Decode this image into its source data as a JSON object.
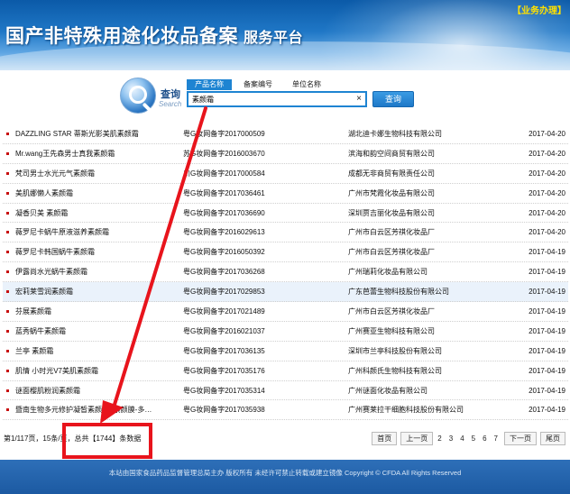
{
  "header": {
    "title": "国产非特殊用途化妆品备案",
    "subtitle": "服务平台",
    "business_link": "【业务办理】"
  },
  "search": {
    "label": "查询",
    "label_en": "Search",
    "tabs": [
      {
        "label": "产品名称",
        "active": true
      },
      {
        "label": "备案编号",
        "active": false
      },
      {
        "label": "单位名称",
        "active": false
      }
    ],
    "value": "素颜霜",
    "clear_symbol": "×",
    "button_label": "查询"
  },
  "results": [
    {
      "name": "DAZZLING STAR 蒂斯光影美肌素颜霜",
      "reg": "粤G妆网备字2017000509",
      "company": "湖北迪卡娜生物科技有限公司",
      "date": "2017-04-20"
    },
    {
      "name": "Mr.wang王先森男士真我素颜霜",
      "reg": "苏G妆网备字2016003670",
      "company": "滨海和韵空间商贸有限公司",
      "date": "2017-04-20"
    },
    {
      "name": "梵司男士水光元气素颜霜",
      "reg": "川G妆网备字2017000584",
      "company": "成都无非商贸有限责任公司",
      "date": "2017-04-20"
    },
    {
      "name": "美肌娜懒人素颜霜",
      "reg": "粤G妆网备字2017036461",
      "company": "广州市梵霞化妆品有限公司",
      "date": "2017-04-20"
    },
    {
      "name": "凝香贝美 素颜霜",
      "reg": "粤G妆网备字2017036690",
      "company": "深圳贾吉丽化妆品有限公司",
      "date": "2017-04-20"
    },
    {
      "name": "薇罗尼卡蜗牛原液滋养素颜霜",
      "reg": "粤G妆网备字2016029613",
      "company": "广州市白云区芳祺化妆品厂",
      "date": "2017-04-20"
    },
    {
      "name": "薇罗尼卡韩国蜗牛素颜霜",
      "reg": "粤G妆网备字2016050392",
      "company": "广州市白云区芳祺化妆品厂",
      "date": "2017-04-19"
    },
    {
      "name": "伊露尚水光蜗牛素颜霜",
      "reg": "粤G妆网备字2017036268",
      "company": "广州瑞莉化妆品有限公司",
      "date": "2017-04-19"
    },
    {
      "name": "宏莉莱雪润素颜霜",
      "reg": "粤G妆网备字2017029853",
      "company": "广东芭蕾生物科技股份有限公司",
      "date": "2017-04-19"
    },
    {
      "name": "芬展素颜霜",
      "reg": "粤G妆网备字2017021489",
      "company": "广州市白云区芳祺化妆品厂",
      "date": "2017-04-19"
    },
    {
      "name": "蓝秀蜗牛素颜霜",
      "reg": "粤G妆网备字2016021037",
      "company": "广州赛亚生物科技有限公司",
      "date": "2017-04-19"
    },
    {
      "name": "兰亭 素颜霜",
      "reg": "粤G妆网备字2017036135",
      "company": "深圳市兰亭科技股份有限公司",
      "date": "2017-04-19"
    },
    {
      "name": "肌情 小时光V7美肌素颜霜",
      "reg": "粤G妆网备字2017035176",
      "company": "广州科颜氏生物科技有限公司",
      "date": "2017-04-19"
    },
    {
      "name": "谜面樱肌粉润素颜霜",
      "reg": "粤G妆网备字2017035314",
      "company": "广州谜面化妆品有限公司",
      "date": "2017-04-19"
    },
    {
      "name": "暨南生物多元修护凝皙素颜霜+素颜膜-多…",
      "reg": "粤G妆网备字2017035938",
      "company": "广州赛莱拉干细胞科技股份有限公司",
      "date": "2017-04-19"
    }
  ],
  "pagination": {
    "info": "第1/117页，15条/页，总共【1744】条数据",
    "first": "首页",
    "prev": "上一页",
    "pages": [
      "2",
      "3",
      "4",
      "5",
      "6",
      "7"
    ],
    "next": "下一页",
    "last": "尾页"
  },
  "footer": {
    "text": "本站由国家食品药品监督管理总局主办 版权所有 未经许可禁止转载或建立镜像 Copyright © CFDA All Rights Reserved"
  },
  "colors": {
    "accent": "#1e84d2",
    "annotation": "#e8141c",
    "header_link": "#ffe100"
  }
}
